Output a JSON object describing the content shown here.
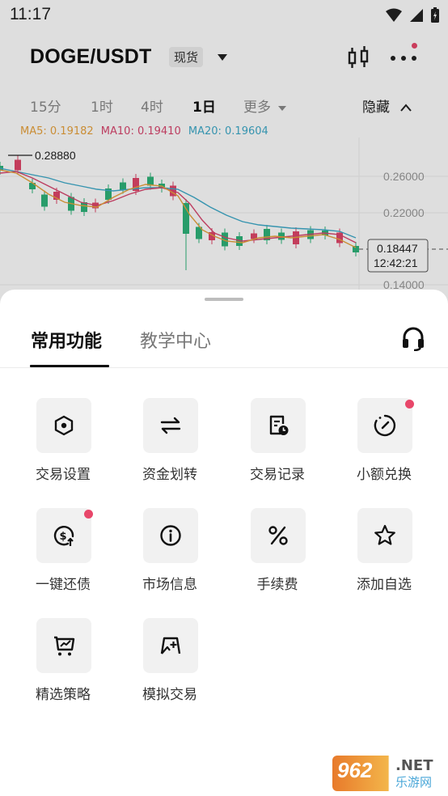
{
  "status": {
    "time": "11:17"
  },
  "header": {
    "pair": "DOGE/USDT",
    "market_type": "现货"
  },
  "timeframes": {
    "items": [
      "15分",
      "1时",
      "4时",
      "1日"
    ],
    "active_index": 3,
    "more": "更多",
    "hide": "隐藏"
  },
  "indicators": {
    "ma5": "MA5: 0.19182",
    "ma10": "MA10: 0.19410",
    "ma20": "MA20: 0.19604",
    "colors": {
      "ma5": "#e8a33d",
      "ma10": "#d9476f",
      "ma20": "#3eaaca"
    }
  },
  "chart": {
    "high_label": "0.28880",
    "price_ticks": [
      "0.26000",
      "0.22000",
      "0.14000"
    ],
    "last_price": "0.18447",
    "countdown": "12:42:21",
    "up_color": "#2eb47a",
    "down_color": "#e0476a"
  },
  "sheet": {
    "tabs": [
      "常用功能",
      "教学中心"
    ],
    "items": [
      {
        "label": "交易设置",
        "icon": "hexagon-settings-icon",
        "dot": false
      },
      {
        "label": "资金划转",
        "icon": "transfer-arrows-icon",
        "dot": false
      },
      {
        "label": "交易记录",
        "icon": "record-clock-icon",
        "dot": false
      },
      {
        "label": "小额兑换",
        "icon": "small-exchange-icon",
        "dot": true
      },
      {
        "label": "一键还债",
        "icon": "repay-dollar-icon",
        "dot": true
      },
      {
        "label": "市场信息",
        "icon": "info-icon",
        "dot": false
      },
      {
        "label": "手续费",
        "icon": "percent-icon",
        "dot": false
      },
      {
        "label": "添加自选",
        "icon": "star-icon",
        "dot": false
      },
      {
        "label": "精选策略",
        "icon": "strategy-chart-icon",
        "dot": false
      },
      {
        "label": "模拟交易",
        "icon": "demo-trade-icon",
        "dot": false
      }
    ]
  },
  "watermark": {
    "number": "962",
    "net": ".NET",
    "sub": "乐游网"
  }
}
